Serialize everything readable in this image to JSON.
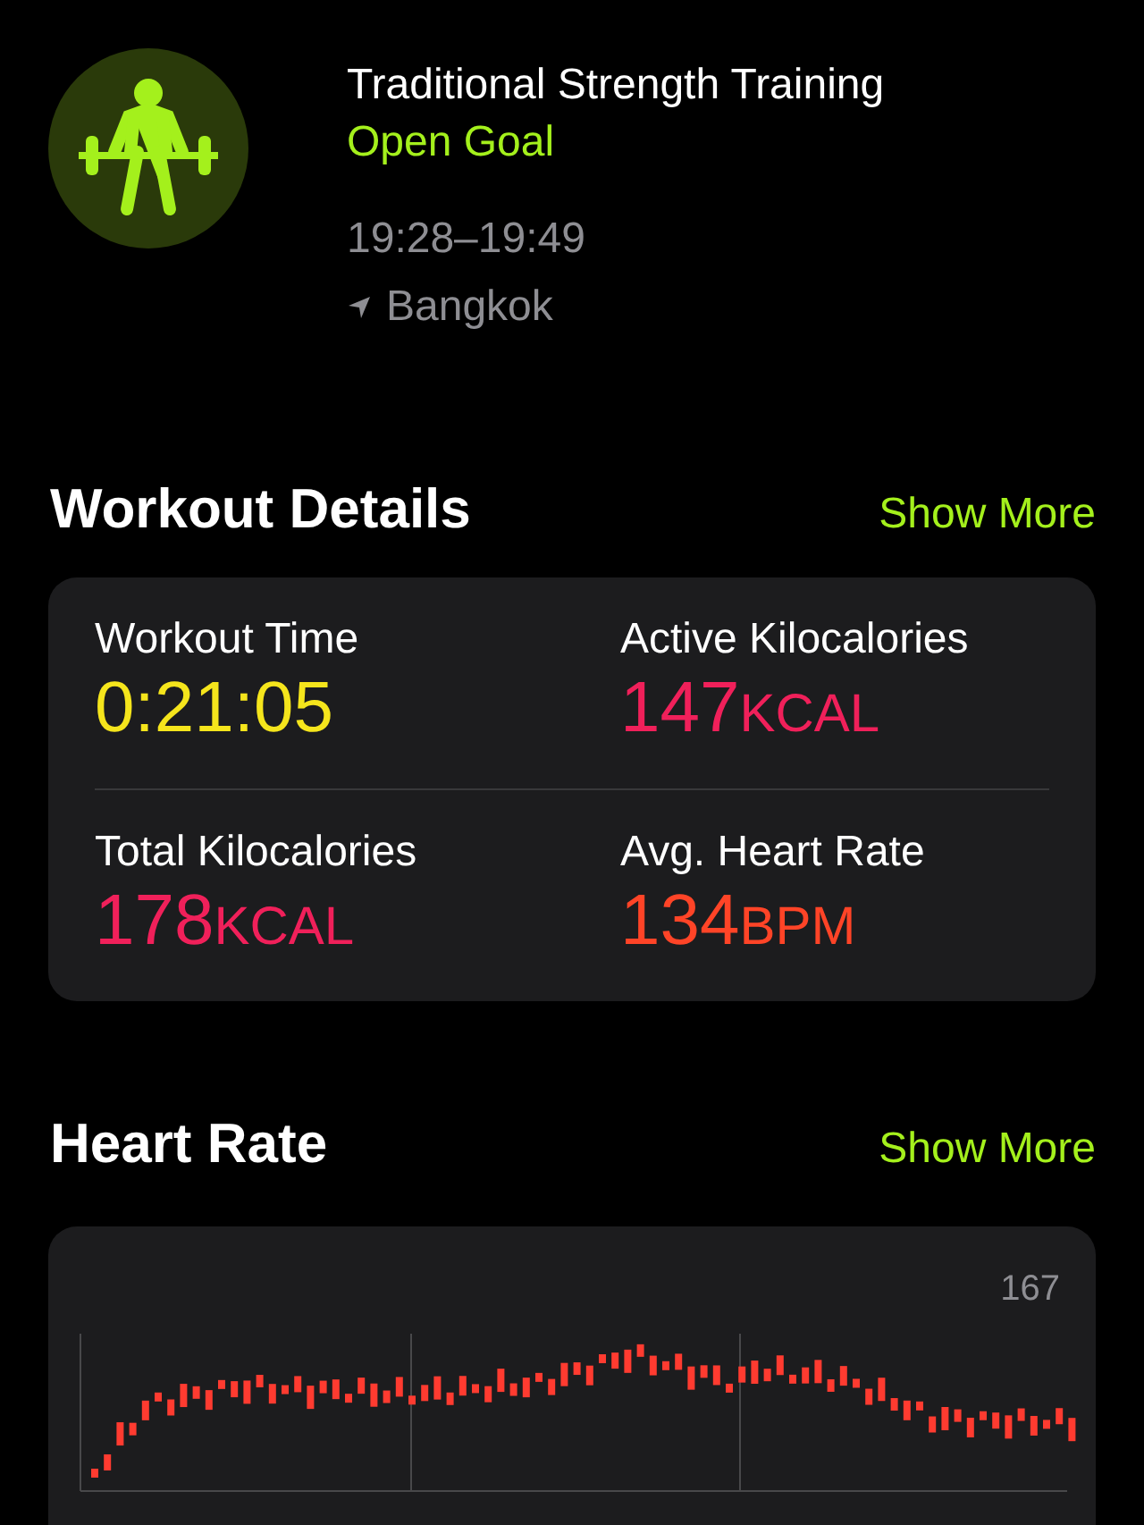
{
  "workout": {
    "title": "Traditional Strength Training",
    "goal": "Open Goal",
    "time_range": "19:28–19:49",
    "location": "Bangkok"
  },
  "workout_details": {
    "heading": "Workout Details",
    "action": "Show More",
    "metrics": [
      {
        "label": "Workout Time",
        "value": "0:21:05",
        "color": "#f5e51c"
      },
      {
        "label": "Active Kilocalories",
        "value": "147",
        "unit": "KCAL",
        "color": "#f0205a"
      },
      {
        "label": "Total Kilocalories",
        "value": "178",
        "unit": "KCAL",
        "color": "#f0205a"
      },
      {
        "label": "Avg. Heart Rate",
        "value": "134",
        "unit": "BPM",
        "color": "#ff4427"
      }
    ]
  },
  "heart_rate": {
    "heading": "Heart Rate",
    "action": "Show More",
    "max_label": "167"
  }
}
